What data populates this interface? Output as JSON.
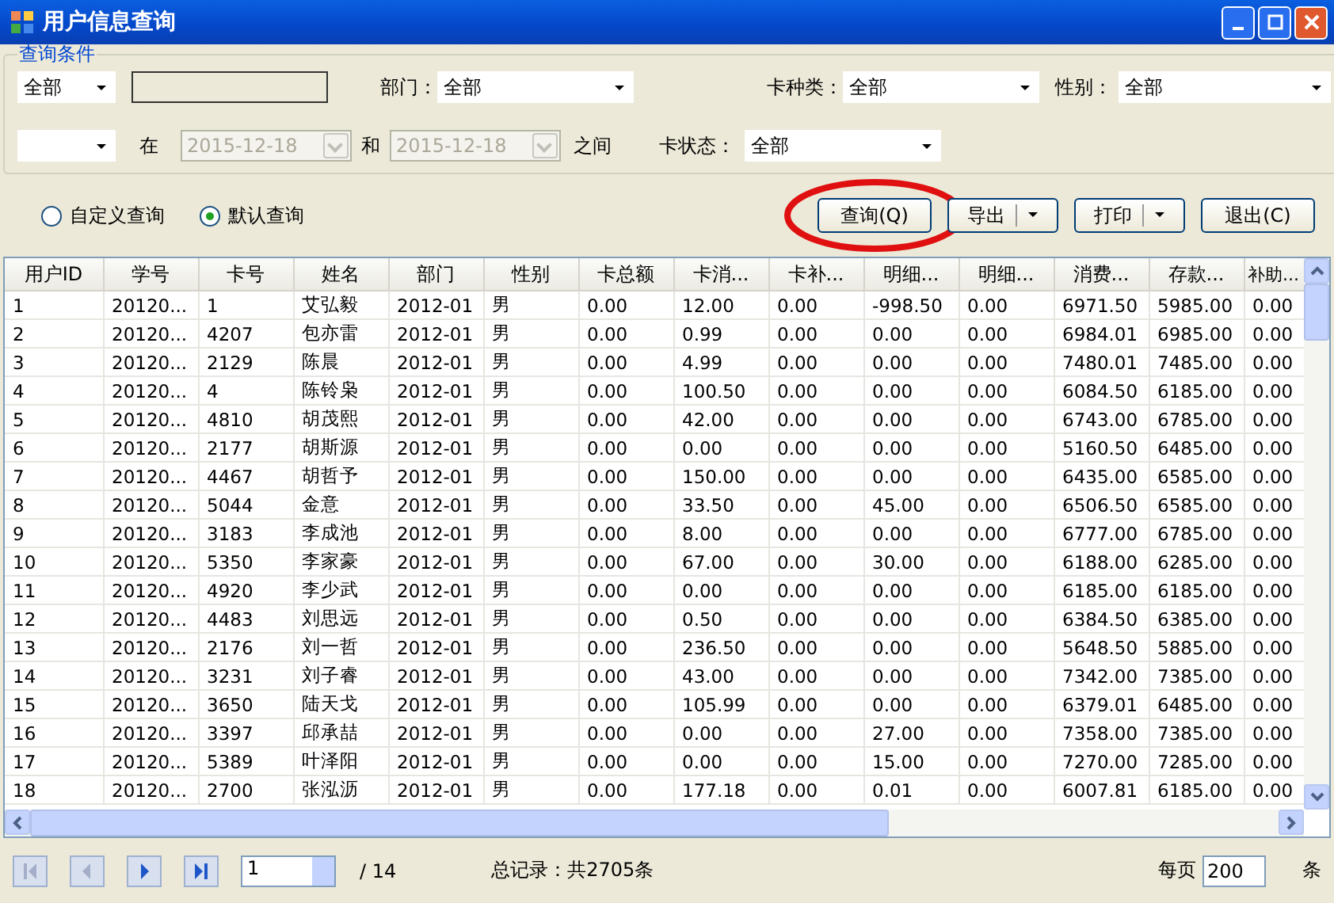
{
  "window": {
    "title": "用户信息查询"
  },
  "filters": {
    "group_title": "查询条件",
    "row1": {
      "field_select": "全部",
      "dept_label": "部门：",
      "dept": "全部",
      "card_type_label": "卡种类：",
      "card_type": "全部",
      "gender_label": "性别：",
      "gender": "全部"
    },
    "row2": {
      "at_label": "在",
      "date_from": {
        "value": "2015-12-18",
        "disabled": true
      },
      "and_label": "和",
      "date_to": {
        "value": "2015-12-18",
        "disabled": true
      },
      "between_label": "之间",
      "status_label": "卡状态：",
      "status": "全部"
    }
  },
  "radios": [
    {
      "label": "自定义查询",
      "selected": false
    },
    {
      "label": "默认查询",
      "selected": true
    }
  ],
  "buttons": [
    {
      "label": "查询(Q)",
      "kind": "plain",
      "highlighted": true
    },
    {
      "label": "导出",
      "kind": "split",
      "highlighted": false
    },
    {
      "label": "打印",
      "kind": "split",
      "highlighted": false
    },
    {
      "label": "退出(C)",
      "kind": "plain",
      "highlighted": false
    }
  ],
  "table": {
    "columns": [
      "用户ID",
      "学号",
      "卡号",
      "姓名",
      "部门",
      "性别",
      "卡总额",
      "卡消...",
      "卡补...",
      "明细...",
      "明细...",
      "消费...",
      "存款...",
      "补助..."
    ],
    "rows": [
      [
        "1",
        "20120...",
        "1",
        "艾弘毅",
        "2012-01",
        "男",
        "0.00",
        "12.00",
        "0.00",
        "-998.50",
        "0.00",
        "6971.50",
        "5985.00",
        "0.00"
      ],
      [
        "2",
        "20120...",
        "4207",
        "包亦雷",
        "2012-01",
        "男",
        "0.00",
        "0.99",
        "0.00",
        "0.00",
        "0.00",
        "6984.01",
        "6985.00",
        "0.00"
      ],
      [
        "3",
        "20120...",
        "2129",
        "陈晨",
        "2012-01",
        "男",
        "0.00",
        "4.99",
        "0.00",
        "0.00",
        "0.00",
        "7480.01",
        "7485.00",
        "0.00"
      ],
      [
        "4",
        "20120...",
        "4",
        "陈铃枭",
        "2012-01",
        "男",
        "0.00",
        "100.50",
        "0.00",
        "0.00",
        "0.00",
        "6084.50",
        "6185.00",
        "0.00"
      ],
      [
        "5",
        "20120...",
        "4810",
        "胡茂熙",
        "2012-01",
        "男",
        "0.00",
        "42.00",
        "0.00",
        "0.00",
        "0.00",
        "6743.00",
        "6785.00",
        "0.00"
      ],
      [
        "6",
        "20120...",
        "2177",
        "胡斯源",
        "2012-01",
        "男",
        "0.00",
        "0.00",
        "0.00",
        "0.00",
        "0.00",
        "5160.50",
        "6485.00",
        "0.00"
      ],
      [
        "7",
        "20120...",
        "4467",
        "胡哲予",
        "2012-01",
        "男",
        "0.00",
        "150.00",
        "0.00",
        "0.00",
        "0.00",
        "6435.00",
        "6585.00",
        "0.00"
      ],
      [
        "8",
        "20120...",
        "5044",
        "金意",
        "2012-01",
        "男",
        "0.00",
        "33.50",
        "0.00",
        "45.00",
        "0.00",
        "6506.50",
        "6585.00",
        "0.00"
      ],
      [
        "9",
        "20120...",
        "3183",
        "李成池",
        "2012-01",
        "男",
        "0.00",
        "8.00",
        "0.00",
        "0.00",
        "0.00",
        "6777.00",
        "6785.00",
        "0.00"
      ],
      [
        "10",
        "20120...",
        "5350",
        "李家豪",
        "2012-01",
        "男",
        "0.00",
        "67.00",
        "0.00",
        "30.00",
        "0.00",
        "6188.00",
        "6285.00",
        "0.00"
      ],
      [
        "11",
        "20120...",
        "4920",
        "李少武",
        "2012-01",
        "男",
        "0.00",
        "0.00",
        "0.00",
        "0.00",
        "0.00",
        "6185.00",
        "6185.00",
        "0.00"
      ],
      [
        "12",
        "20120...",
        "4483",
        "刘思远",
        "2012-01",
        "男",
        "0.00",
        "0.50",
        "0.00",
        "0.00",
        "0.00",
        "6384.50",
        "6385.00",
        "0.00"
      ],
      [
        "13",
        "20120...",
        "2176",
        "刘一哲",
        "2012-01",
        "男",
        "0.00",
        "236.50",
        "0.00",
        "0.00",
        "0.00",
        "5648.50",
        "5885.00",
        "0.00"
      ],
      [
        "14",
        "20120...",
        "3231",
        "刘子睿",
        "2012-01",
        "男",
        "0.00",
        "43.00",
        "0.00",
        "0.00",
        "0.00",
        "7342.00",
        "7385.00",
        "0.00"
      ],
      [
        "15",
        "20120...",
        "3650",
        "陆天戈",
        "2012-01",
        "男",
        "0.00",
        "105.99",
        "0.00",
        "0.00",
        "0.00",
        "6379.01",
        "6485.00",
        "0.00"
      ],
      [
        "16",
        "20120...",
        "3397",
        "邱承喆",
        "2012-01",
        "男",
        "0.00",
        "0.00",
        "0.00",
        "27.00",
        "0.00",
        "7358.00",
        "7385.00",
        "0.00"
      ],
      [
        "17",
        "20120...",
        "5389",
        "叶泽阳",
        "2012-01",
        "男",
        "0.00",
        "0.00",
        "0.00",
        "15.00",
        "0.00",
        "7270.00",
        "7285.00",
        "0.00"
      ],
      [
        "18",
        "20120...",
        "2700",
        "张泓沥",
        "2012-01",
        "男",
        "0.00",
        "177.18",
        "0.00",
        "0.01",
        "0.00",
        "6007.81",
        "6185.00",
        "0.00"
      ]
    ]
  },
  "pager": {
    "nav": [
      {
        "kind": "first",
        "disabled": true
      },
      {
        "kind": "prev",
        "disabled": true
      },
      {
        "kind": "next",
        "disabled": false
      },
      {
        "kind": "last",
        "disabled": false
      }
    ],
    "page": "1",
    "total_pages": "/ 14",
    "record_text": "总记录：共2705条",
    "per_page_label": "每页",
    "per_page": "200",
    "unit": "条"
  }
}
